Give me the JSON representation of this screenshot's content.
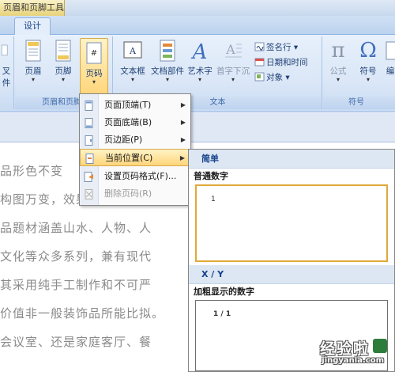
{
  "window": {
    "context_tab_title": "页眉和页脚工具"
  },
  "tabs": {
    "design": "设计"
  },
  "ribbon": {
    "left_cut": {
      "label1": "叉",
      "label2": "件"
    },
    "header_footer_group": {
      "label": "页眉和页脚",
      "header_label": "页眉",
      "footer_label": "页脚",
      "page_number_label": "页码"
    },
    "text_group": {
      "label": "文本",
      "textbox_label": "文本框",
      "quickparts_label": "文档部件",
      "wordart_label": "艺术字",
      "dropcap_label": "首字下沉",
      "signature_label": "签名行",
      "datetime_label": "日期和时间",
      "object_label": "对象"
    },
    "symbol_group": {
      "label": "符号",
      "formula_label": "公式",
      "symbol_label": "符号",
      "more_label": "编"
    }
  },
  "page_number_menu": {
    "items": [
      {
        "label": "页面顶端(T)",
        "has_submenu": true
      },
      {
        "label": "页面底端(B)",
        "has_submenu": true
      },
      {
        "label": "页边距(P)",
        "has_submenu": true
      },
      {
        "label": "当前位置(C)",
        "has_submenu": true
      },
      {
        "label": "设置页码格式(F)..."
      },
      {
        "label": "删除页码(R)"
      }
    ]
  },
  "gallery": {
    "section1_title": "简单",
    "item1_name": "普通数字",
    "item1_preview": "1",
    "section2_title": "X / Y",
    "item2_name": "加粗显示的数字",
    "item2_preview": "1 / 1"
  },
  "document": {
    "lines": [
      "品形色不变",
      "构图万变，效果令人惊叹。装",
      "品题材涵盖山水、人物、人",
      "文化等众多系列，兼有现代",
      "其采用纯手工制作和不可严",
      "价值非一般装饰品所能比拟。",
      "会议室、还是家庭客厅、餐"
    ]
  },
  "watermark": {
    "title": "经验啦",
    "url": "jingyanla.com"
  }
}
